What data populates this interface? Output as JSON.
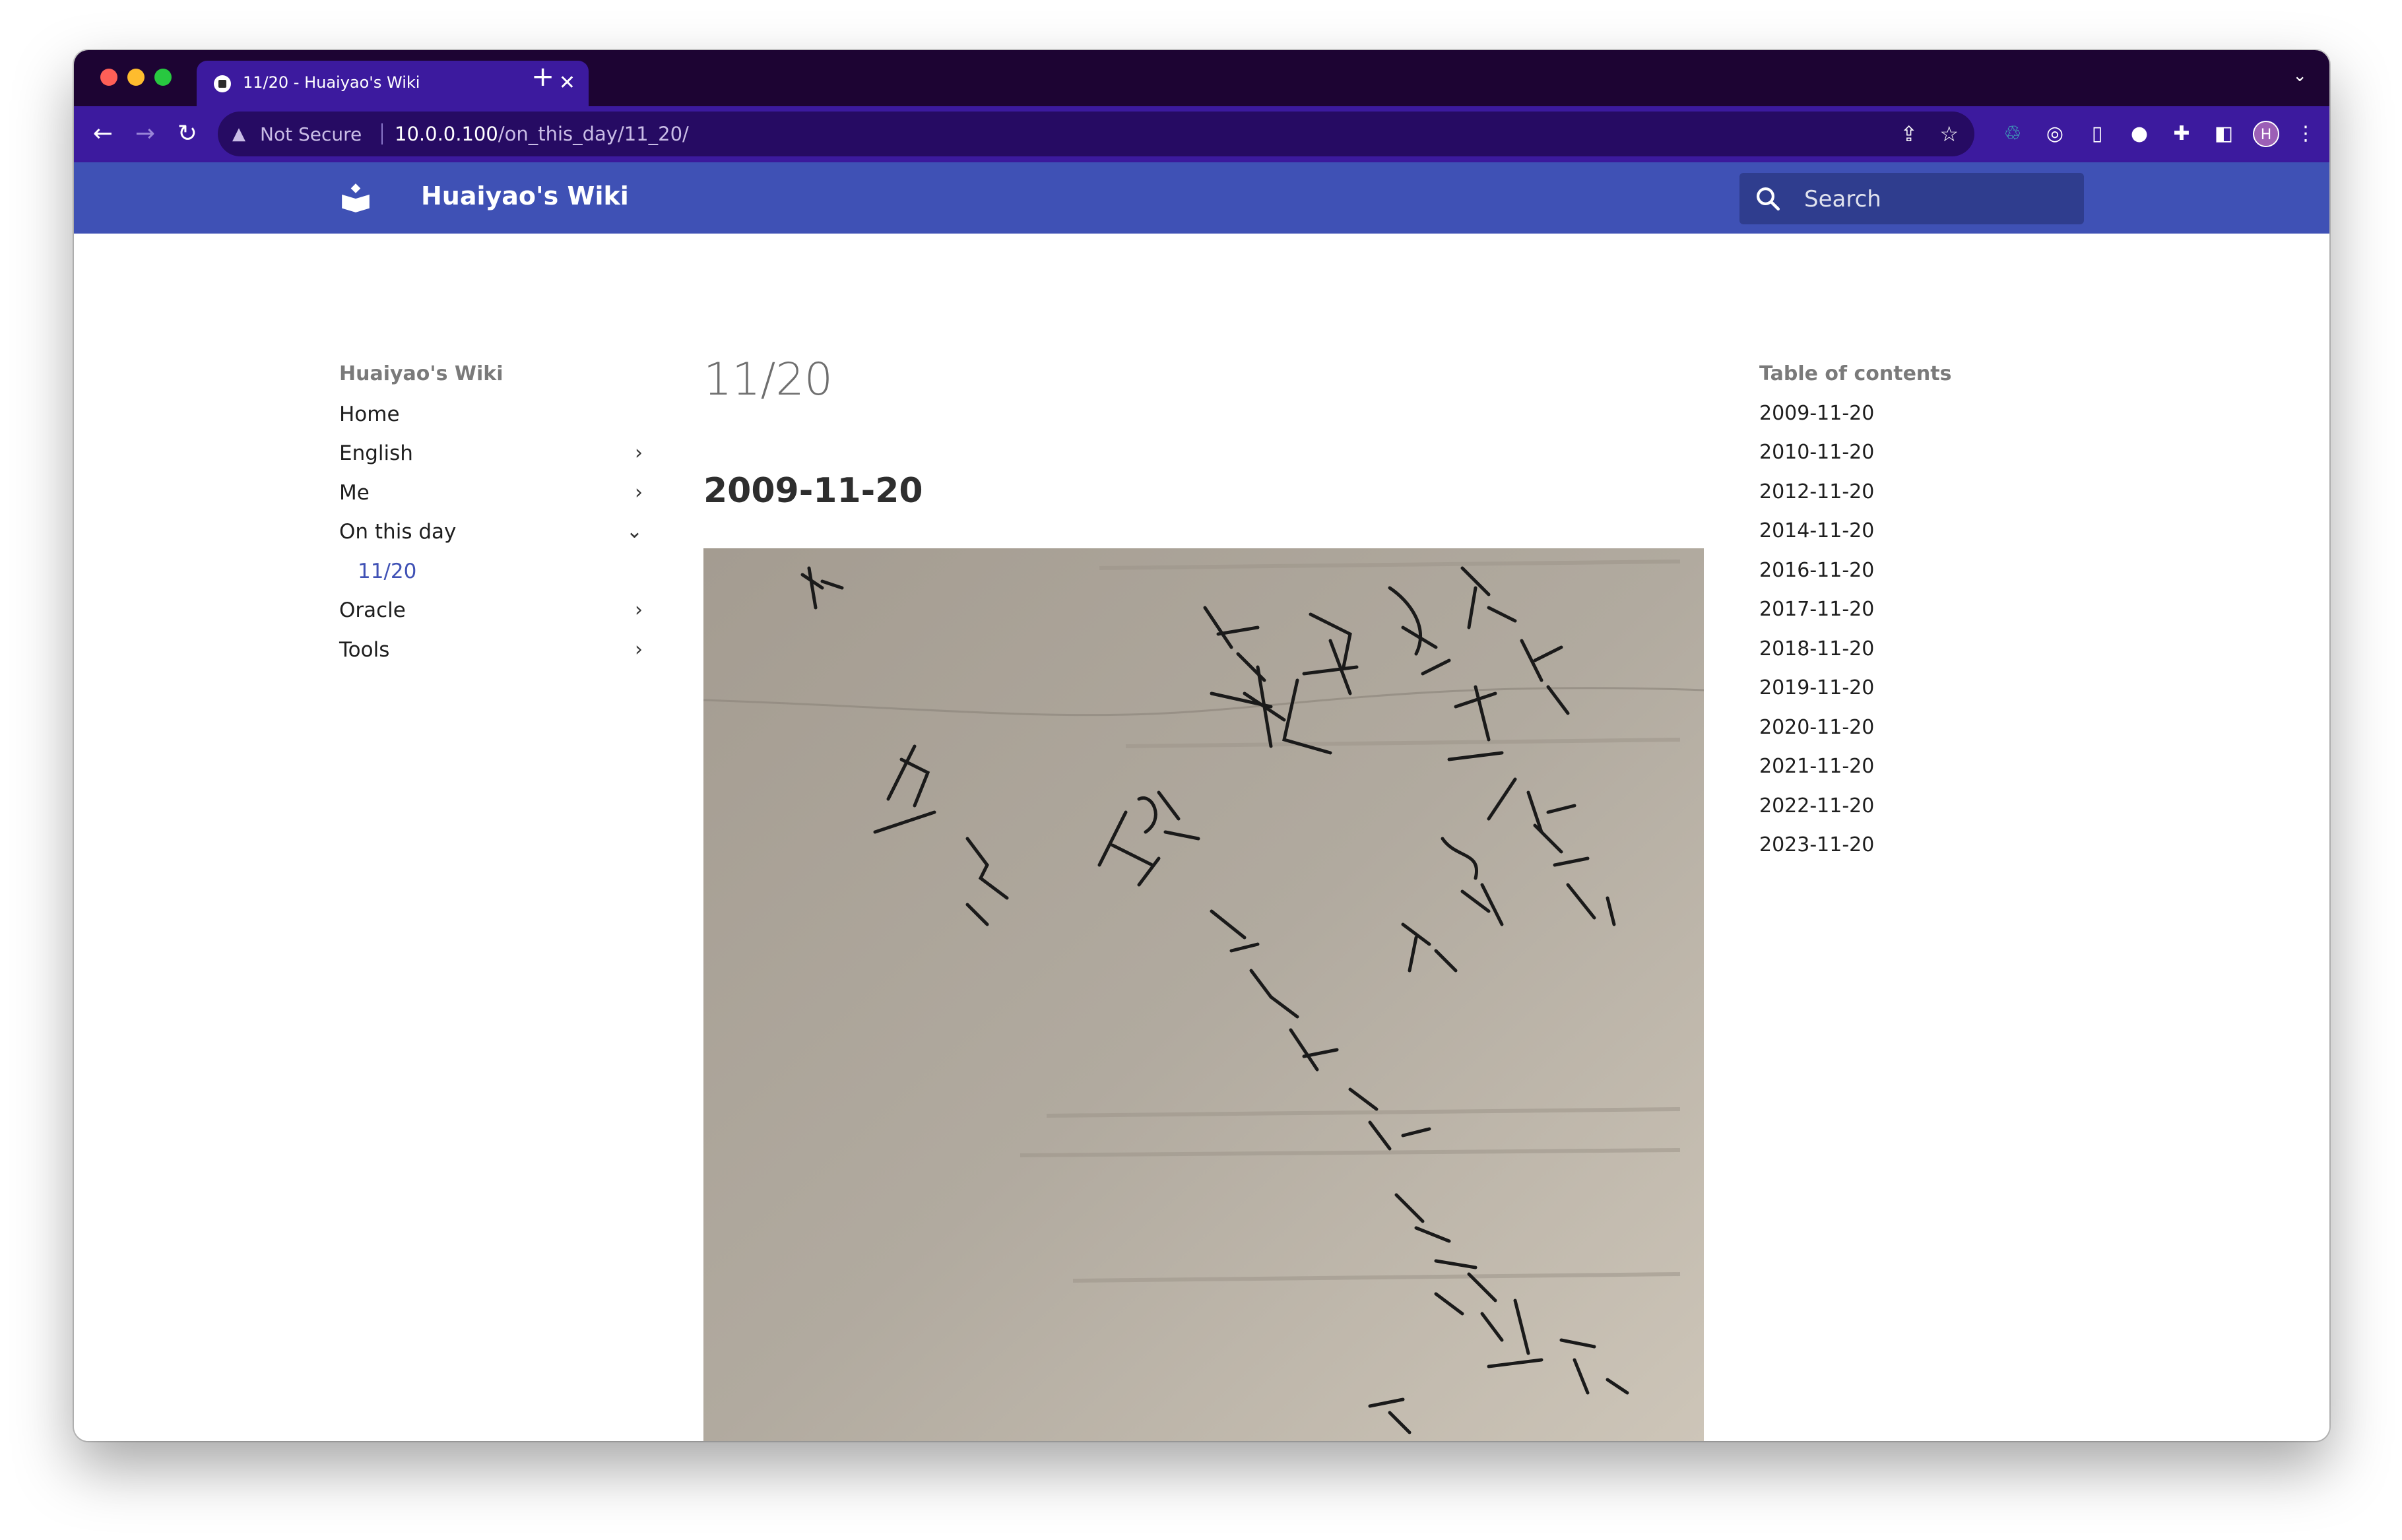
{
  "browser": {
    "tab_title": "11/20 - Huaiyao's Wiki",
    "security_label": "Not Secure",
    "url_host": "10.0.0.100",
    "url_path": "/on_this_day/11_20/",
    "profile_initial": "H"
  },
  "site": {
    "title": "Huaiyao's Wiki",
    "search_placeholder": "Search",
    "brand_color": "#3f51b5"
  },
  "nav": {
    "heading": "Huaiyao's Wiki",
    "items": [
      {
        "label": "Home",
        "expandable": false
      },
      {
        "label": "English",
        "expandable": true
      },
      {
        "label": "Me",
        "expandable": true
      },
      {
        "label": "On this day",
        "expandable": true,
        "expanded": true
      },
      {
        "label": "11/20",
        "active": true
      },
      {
        "label": "Oracle",
        "expandable": true
      },
      {
        "label": "Tools",
        "expandable": true
      }
    ]
  },
  "page": {
    "title": "11/20",
    "section_heading": "2009-11-20"
  },
  "toc": {
    "heading": "Table of contents",
    "items": [
      "2009-11-20",
      "2010-11-20",
      "2012-11-20",
      "2014-11-20",
      "2016-11-20",
      "2017-11-20",
      "2018-11-20",
      "2019-11-20",
      "2020-11-20",
      "2021-11-20",
      "2022-11-20",
      "2023-11-20"
    ]
  }
}
